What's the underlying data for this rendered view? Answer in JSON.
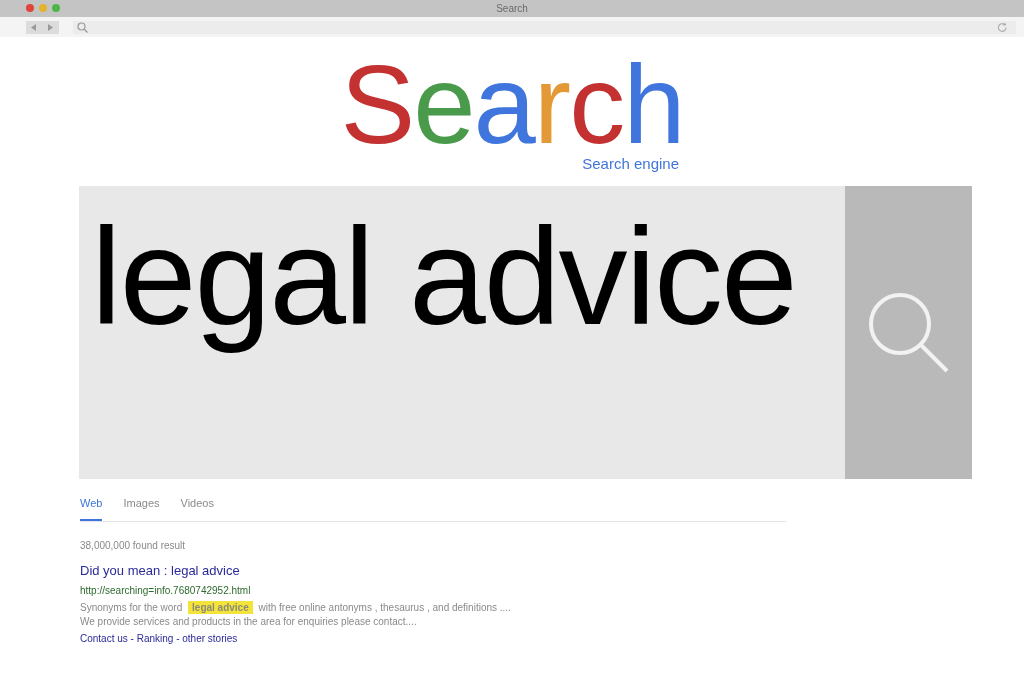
{
  "window": {
    "title": "Search"
  },
  "logo": {
    "text": "Search",
    "subtitle": "Search engine"
  },
  "search": {
    "value": "legal advice"
  },
  "tabs": [
    {
      "label": "Web",
      "selected": true
    },
    {
      "label": "Images",
      "selected": false
    },
    {
      "label": "Videos",
      "selected": false
    }
  ],
  "result_count": "38,000,000 found result",
  "result": {
    "title": "Did you mean : legal advice",
    "url": "http://searching=info.7680742952.html",
    "snippet": "Synonyms for the word **legal advice** with free online antonyms , thesaurus , and definitions ....",
    "snippet_2": "We provide services and products in the area for enquiries please contact....",
    "links": "Contact us - Ranking - other stories"
  }
}
